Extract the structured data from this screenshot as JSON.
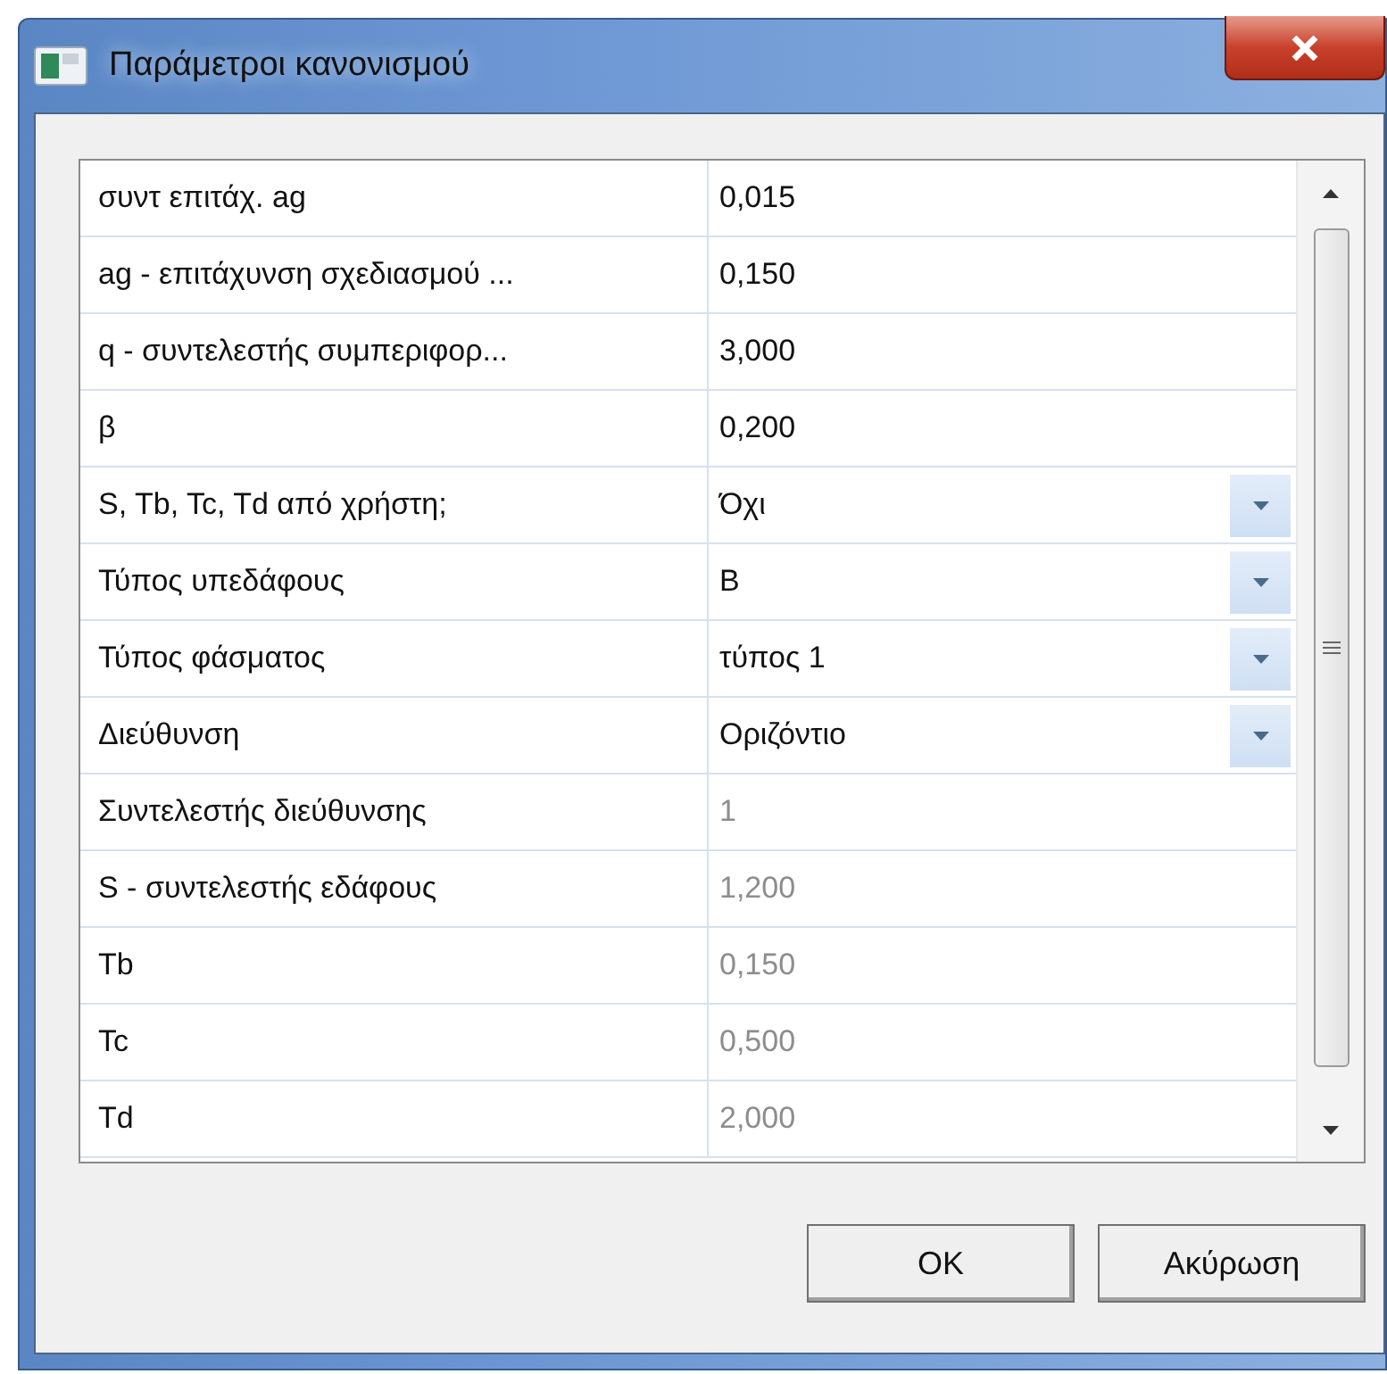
{
  "window": {
    "title": "Παράμετροι κανονισμού"
  },
  "properties": [
    {
      "label": "συντ επιτάχ. ag",
      "value": "0,015",
      "kind": "text",
      "disabled": false
    },
    {
      "label": "ag - επιτάχυνση σχεδιασμού ...",
      "value": "0,150",
      "kind": "text",
      "disabled": false
    },
    {
      "label": "q - συντελεστής συμπεριφορ...",
      "value": "3,000",
      "kind": "text",
      "disabled": false
    },
    {
      "label": "β",
      "value": "0,200",
      "kind": "text",
      "disabled": false
    },
    {
      "label": "S, Tb, Tc, Td από χρήστη;",
      "value": "Όχι",
      "kind": "dropdown",
      "disabled": false
    },
    {
      "label": "Τύπος υπεδάφους",
      "value": "B",
      "kind": "dropdown",
      "disabled": false
    },
    {
      "label": "Τύπος φάσματος",
      "value": "τύπος 1",
      "kind": "dropdown",
      "disabled": false
    },
    {
      "label": "Διεύθυνση",
      "value": "Οριζόντιο",
      "kind": "dropdown",
      "disabled": false
    },
    {
      "label": "Συντελεστής διεύθυνσης",
      "value": "1",
      "kind": "text",
      "disabled": true
    },
    {
      "label": "S - συντελεστής εδάφους",
      "value": "1,200",
      "kind": "text",
      "disabled": true
    },
    {
      "label": "Tb",
      "value": "0,150",
      "kind": "text",
      "disabled": true
    },
    {
      "label": "Tc",
      "value": "0,500",
      "kind": "text",
      "disabled": true
    },
    {
      "label": "Td",
      "value": "2,000",
      "kind": "text",
      "disabled": true
    }
  ],
  "buttons": [
    "OK",
    "Ακύρωση"
  ]
}
